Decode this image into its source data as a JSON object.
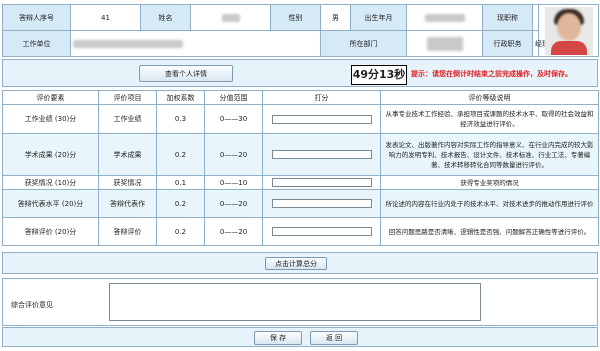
{
  "info": {
    "respondent_no_label": "答辩人序号",
    "respondent_no": "41",
    "name_label": "姓名",
    "gender_label": "性别",
    "gender": "男",
    "birth_label": "出生年月",
    "title_label": "现职称",
    "unit_label": "工作单位",
    "dept_label": "所在部门",
    "admin_label": "行政职务",
    "admin": "经理"
  },
  "toolbar": {
    "details_button": "查看个人详情",
    "timer": "49分13秒",
    "tip": "提示：请您在倒计时结束之前完成操作，及时保存。"
  },
  "eval": {
    "headers": [
      "评价要素",
      "评价项目",
      "加权系数",
      "分值范围",
      "打分",
      "评价等级说明"
    ],
    "rows": [
      {
        "factor": "工作业绩 (30)分",
        "item": "工作业绩",
        "weight": "0.3",
        "range": "0——30",
        "desc": "从事专业技术工作经验、承担项目或课题的技术水平、取得的社会效益和经济效益进行评价。"
      },
      {
        "factor": "学术成果 (20)分",
        "item": "学术成果",
        "weight": "0.2",
        "range": "0——20",
        "desc": "发表论文、出版著作内容对实际工作的指导意义、在行业内完成的较大影响力的发明专利、技术报告、设计文件、技术标准、行业工法、专著编著、技术转移转化合同等数量进行评价。"
      },
      {
        "factor": "获奖情况 (10)分",
        "item": "获奖情况",
        "weight": "0.1",
        "range": "0——10",
        "desc": "获得专业奖项的情况"
      },
      {
        "factor": "答辩代表水平 (20)分",
        "item": "答辩代表作",
        "weight": "0.2",
        "range": "0——20",
        "desc": "所论述的内容在行业内处于的技术水平、对技术进步的推动作用进行评价"
      },
      {
        "factor": "答辩评价 (20)分",
        "item": "答辩评价",
        "weight": "0.2",
        "range": "0——20",
        "desc": "回答问题思路是否清晰、逻辑性是否强、问题解答正确性等进行评价。"
      }
    ],
    "calc_button": "点击计算总分"
  },
  "comment": {
    "label": "综合评价意见",
    "value": ""
  },
  "actions": {
    "save": "保 存",
    "back": "返 回"
  }
}
